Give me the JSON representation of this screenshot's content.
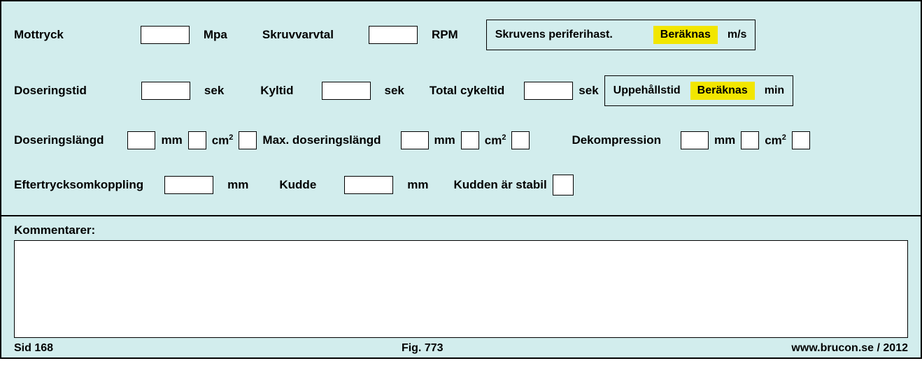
{
  "row1": {
    "mottryck": "Mottryck",
    "mpa": "Mpa",
    "skruvvarvtal": "Skruvvarvtal",
    "rpm": "RPM",
    "periferihast_label": "Skruvens periferihast.",
    "beraknas": "Beräknas",
    "ms": "m/s"
  },
  "row2": {
    "doseringstid": "Doseringstid",
    "sek1": "sek",
    "kyltid": "Kyltid",
    "sek2": "sek",
    "totalcykel": "Total cykeltid",
    "sek3": "sek",
    "uppehall": "Uppehållstid",
    "beraknas": "Beräknas",
    "min": "min"
  },
  "row3": {
    "doseringslangd": "Doseringslängd",
    "mm1": "mm",
    "cm1a": "cm",
    "sup": "2",
    "maxdos": "Max. doseringslängd",
    "mm2": "mm",
    "cm2a": "cm",
    "dekompression": "Dekompression",
    "mm3": "mm",
    "cm3a": "cm"
  },
  "row4": {
    "eftertryck": "Eftertrycksomkoppling",
    "mm1": "mm",
    "kudde": "Kudde",
    "mm2": "mm",
    "stabil": "Kudden är stabil"
  },
  "comments": {
    "label": "Kommentarer:"
  },
  "footer": {
    "sid": "Sid 168",
    "fig": "Fig. 773",
    "src": "www.brucon.se / 2012"
  }
}
